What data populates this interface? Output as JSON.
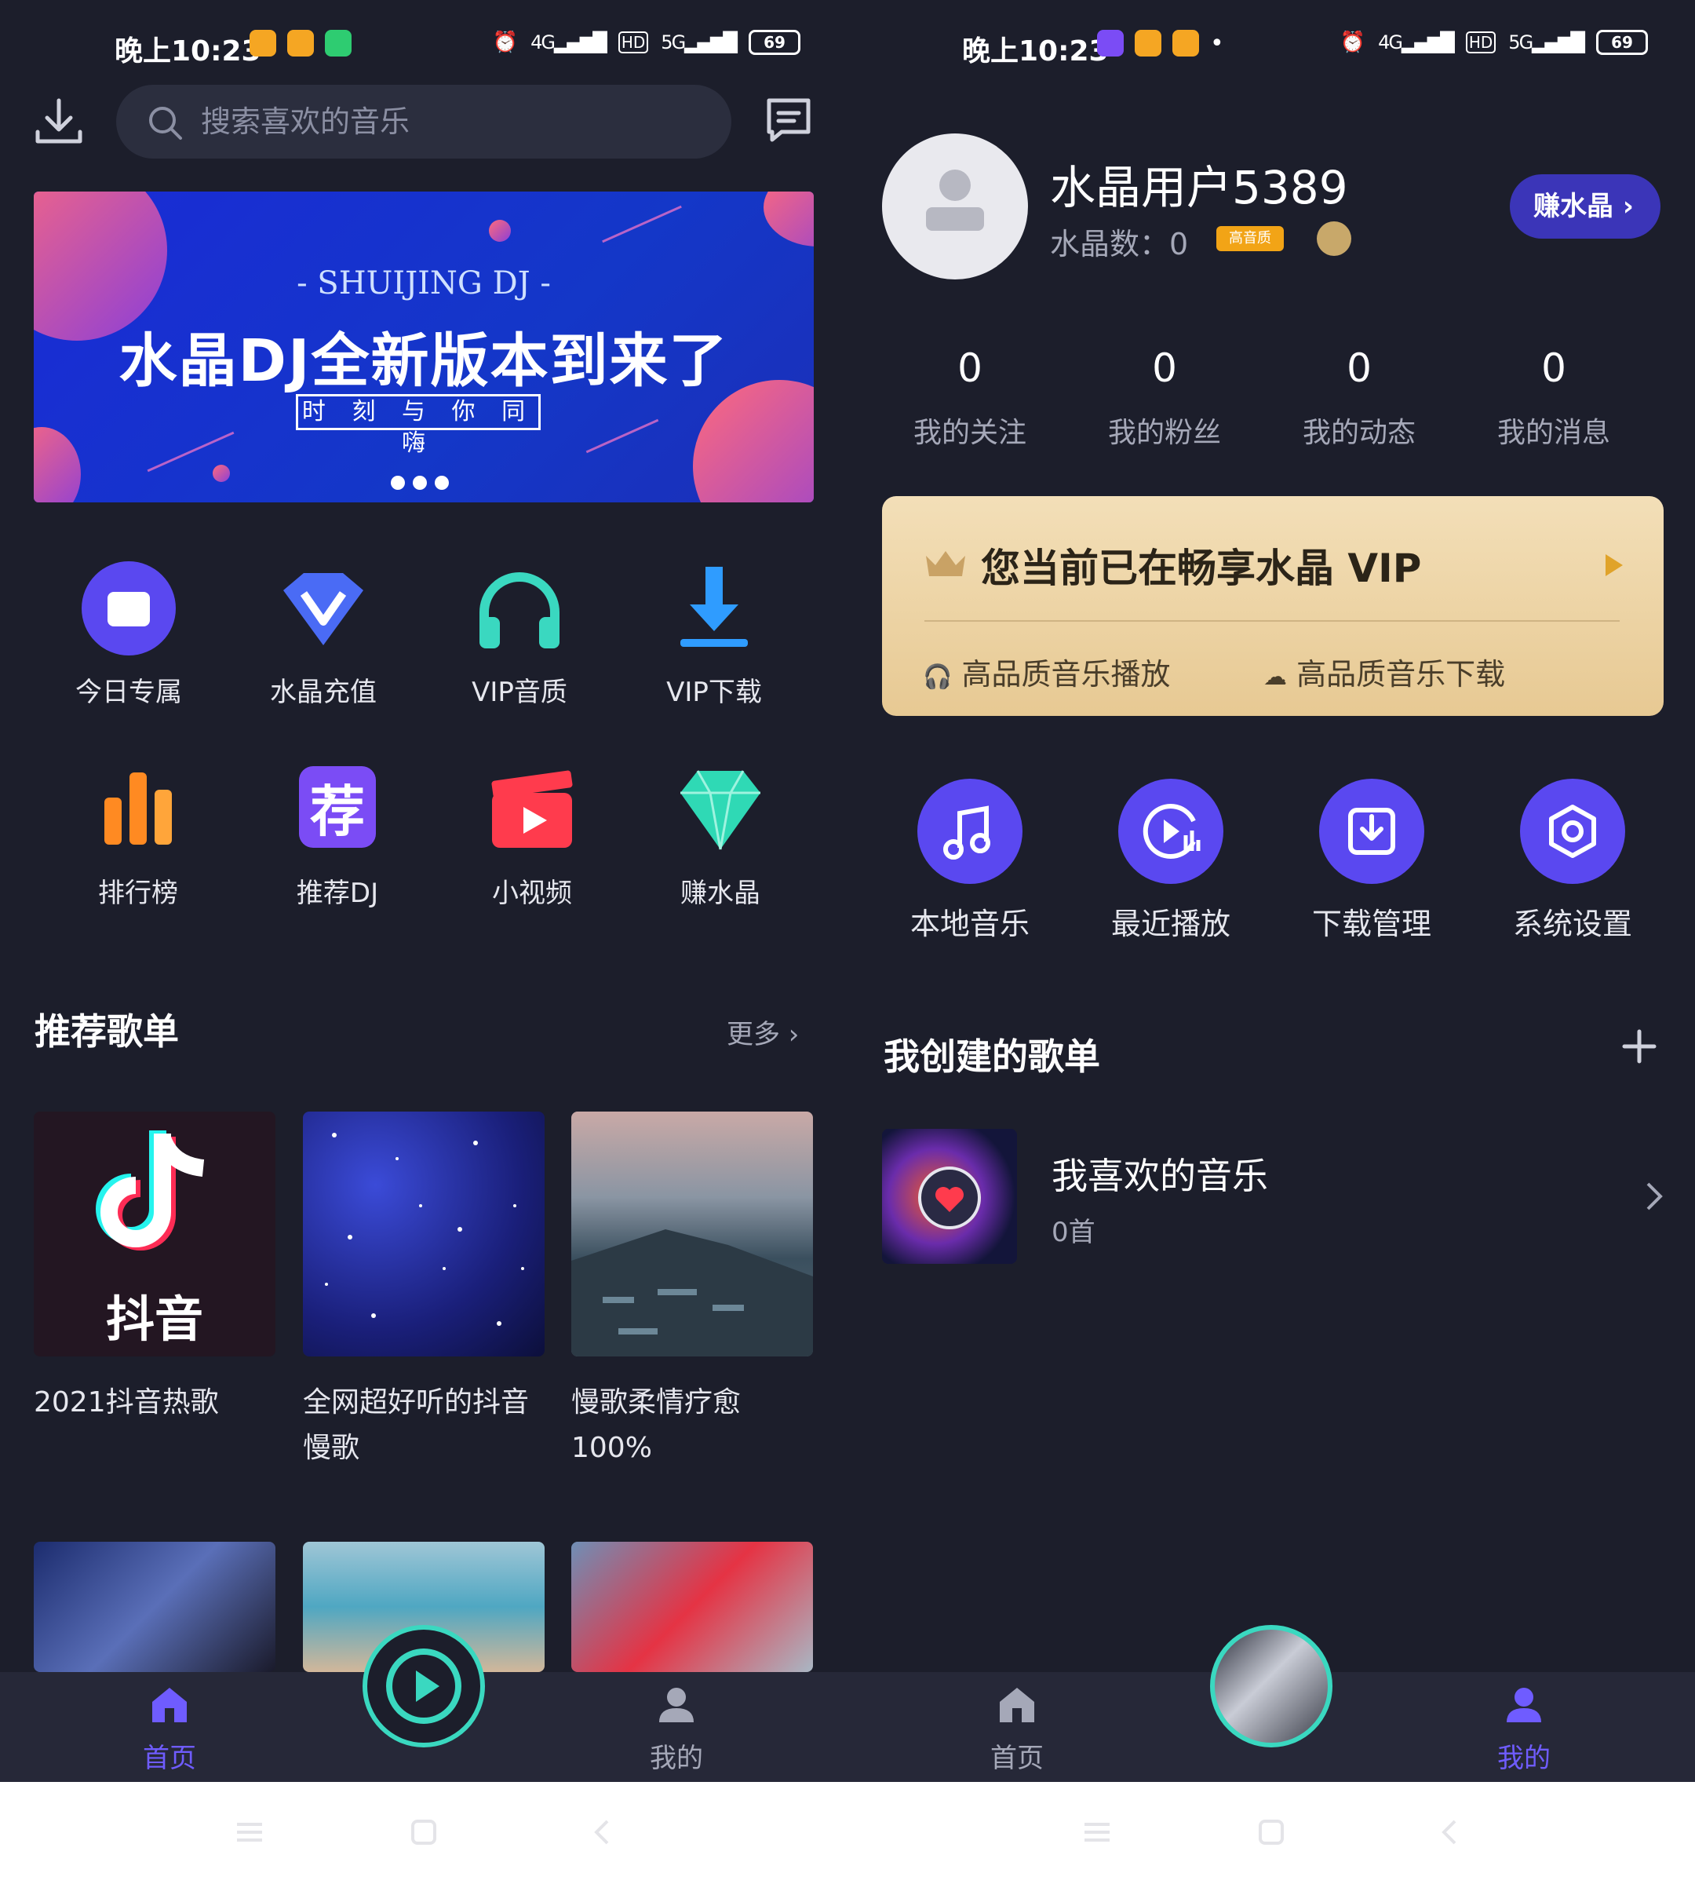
{
  "status_bar": {
    "time": "晚上10:23",
    "battery": "69",
    "net1": "4G",
    "hd": "HD",
    "net2": "5G"
  },
  "home": {
    "search_placeholder": "搜索喜欢的音乐",
    "banner": {
      "subtitle": "- SHUIJING DJ -",
      "title": "水晶DJ全新版本到来了",
      "tag": "时 刻 与 你 同 嗨"
    },
    "grid": [
      {
        "label": "今日专属",
        "icon": "calendar-icon"
      },
      {
        "label": "水晶充值",
        "icon": "diamond-v-icon"
      },
      {
        "label": "VIP音质",
        "icon": "headphones-icon"
      },
      {
        "label": "VIP下载",
        "icon": "download-icon"
      },
      {
        "label": "排行榜",
        "icon": "bar-chart-icon"
      },
      {
        "label": "推荐DJ",
        "icon": "recommend-icon"
      },
      {
        "label": "小视频",
        "icon": "clapper-icon"
      },
      {
        "label": "赚水晶",
        "icon": "gem-icon"
      }
    ],
    "section_title": "推荐歌单",
    "more_label": "更多",
    "playlists": [
      {
        "line1": "2021抖音热歌",
        "line2": "",
        "cover_text": "抖音"
      },
      {
        "line1": "全网超好听的抖音",
        "line2": "慢歌"
      },
      {
        "line1": "慢歌柔情疗愈",
        "line2": "100%"
      }
    ]
  },
  "profile": {
    "username": "水晶用户5389",
    "crystal_count": "水晶数：0",
    "badge_text": "高音质",
    "earn_button": "赚水晶",
    "stats": [
      {
        "num": "0",
        "label": "我的关注"
      },
      {
        "num": "0",
        "label": "我的粉丝"
      },
      {
        "num": "0",
        "label": "我的动态"
      },
      {
        "num": "0",
        "label": "我的消息"
      }
    ],
    "vip": {
      "title": "您当前已在畅享水晶 VIP",
      "feature1": "高品质音乐播放",
      "feature2": "高品质音乐下载"
    },
    "tools": [
      {
        "label": "本地音乐",
        "icon": "music-note-icon"
      },
      {
        "label": "最近播放",
        "icon": "recent-play-icon"
      },
      {
        "label": "下载管理",
        "icon": "download-box-icon"
      },
      {
        "label": "系统设置",
        "icon": "gear-icon"
      }
    ],
    "section_title": "我创建的歌单",
    "my_playlist": {
      "name": "我喜欢的音乐",
      "count": "0首"
    }
  },
  "nav": {
    "home": "首页",
    "mine": "我的"
  },
  "colors": {
    "bg": "#1c1e2b",
    "accent": "#5a48f0",
    "active": "#6f5cff",
    "teal": "#3ad8c0",
    "gold": "#e7c993"
  }
}
